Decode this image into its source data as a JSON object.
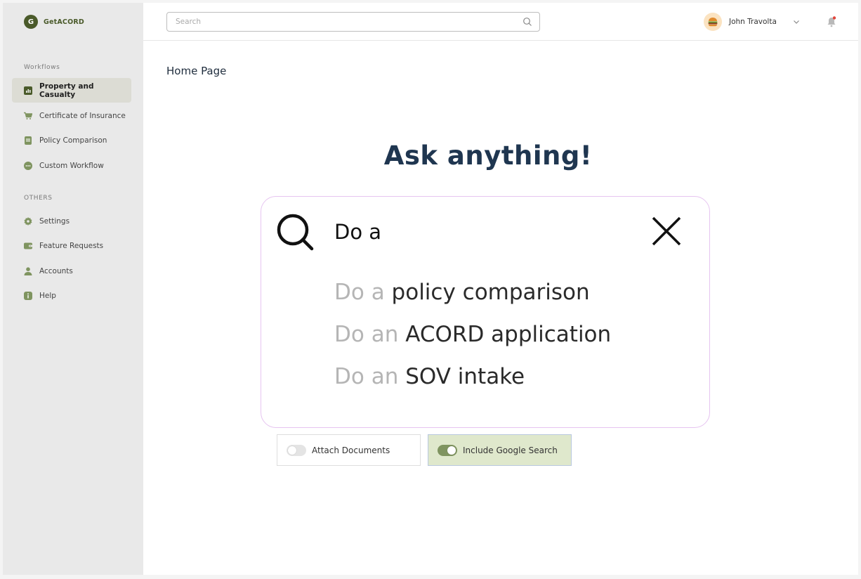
{
  "brand": {
    "logo_letter": "G",
    "name": "GetACORD",
    "color": "#4a5a2a"
  },
  "sidebar": {
    "workflows_title": "Workflows",
    "workflows": [
      {
        "label": "Property and Casualty",
        "icon": "bar-chart-icon",
        "active": true
      },
      {
        "label": "Certificate of Insurance",
        "icon": "cart-icon",
        "active": false
      },
      {
        "label": "Policy Comparison",
        "icon": "document-icon",
        "active": false
      },
      {
        "label": "Custom Workflow",
        "icon": "chat-icon",
        "active": false
      }
    ],
    "others_title": "OTHERS",
    "others": [
      {
        "label": "Settings",
        "icon": "gear-icon"
      },
      {
        "label": "Feature Requests",
        "icon": "wallet-icon"
      },
      {
        "label": "Accounts",
        "icon": "user-icon"
      },
      {
        "label": "Help",
        "icon": "info-icon"
      }
    ]
  },
  "header": {
    "search_placeholder": "Search",
    "user_name": "John Travolta"
  },
  "main": {
    "page_title": "Home Page",
    "hero": "Ask anything!",
    "query": "Do a",
    "suggestions": [
      {
        "prefix": "Do a",
        "rest": "policy comparison"
      },
      {
        "prefix": "Do an",
        "rest": "ACORD application"
      },
      {
        "prefix": "Do an",
        "rest": "SOV intake"
      }
    ],
    "toggles": [
      {
        "label": "Attach Documents",
        "on": false
      },
      {
        "label": "Include Google Search",
        "on": true
      }
    ]
  },
  "colors": {
    "accent": "#4a5a2a",
    "card_border": "#e6c4f0",
    "toggle_on_bg": "#dfe8cc",
    "notification_dot": "#e2463c"
  }
}
